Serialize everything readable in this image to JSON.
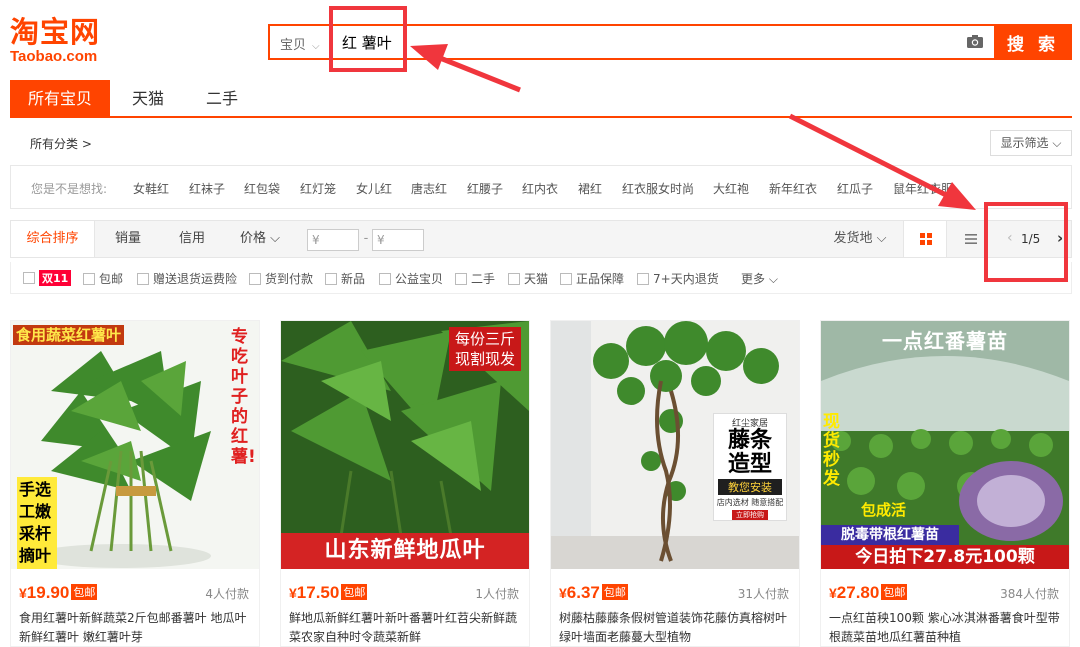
{
  "header": {
    "logo_cn": "淘宝网",
    "logo_en": "Taobao.com",
    "search_type": "宝贝",
    "search_value": "红 薯叶",
    "search_button": "搜 索"
  },
  "tabs": [
    {
      "label": "所有宝贝"
    },
    {
      "label": "天猫"
    },
    {
      "label": "二手"
    }
  ],
  "category": {
    "all_label": "所有分类 >",
    "show_filter": "显示筛选 ⌵"
  },
  "suggest": {
    "label": "您是不是想找:",
    "items": [
      "女鞋红",
      "红袜子",
      "红包袋",
      "红灯笼",
      "女儿红",
      "唐志红",
      "红腰子",
      "红内衣",
      "裙红",
      "红衣服女时尚",
      "大红袍",
      "新年红衣",
      "红瓜子",
      "鼠年红衣服"
    ]
  },
  "sortbar": {
    "items": [
      "综合排序",
      "销量",
      "信用",
      "价格 ⌵"
    ],
    "price_from": "¥",
    "price_to": "¥",
    "dash": "-",
    "ship_from": "发货地 ⌵",
    "pager": "1/5"
  },
  "filters": {
    "d11": "双11",
    "items": [
      "包邮",
      "赠送退货运费险",
      "货到付款",
      "新品",
      "公益宝贝",
      "二手",
      "天猫",
      "正品保障",
      "7+天内退货"
    ],
    "more": "更多 ⌵"
  },
  "products": [
    {
      "price": "19.90",
      "yen": "¥",
      "badge": "包邮",
      "paid": "4人付款",
      "title": "食用红薯叶新鲜蔬菜2斤包邮番薯叶 地瓜叶新鲜红薯叶 嫩红薯叶芽",
      "img_top": "食用蔬菜红薯叶",
      "img_side": "专吃叶子的红薯!",
      "img_bottom": "手选工嫩采杆摘叶"
    },
    {
      "price": "17.50",
      "yen": "¥",
      "badge": "包邮",
      "paid": "1人付款",
      "title": "鲜地瓜新鲜红薯叶新叶番薯叶红苕尖新鲜蔬菜农家自种时令蔬菜新鲜",
      "img_top1": "每份三斤",
      "img_top2": "现割现发",
      "img_bottom": "山东新鲜地瓜叶"
    },
    {
      "price": "6.37",
      "yen": "¥",
      "badge": "包邮",
      "paid": "31人付款",
      "title": "树藤枯藤藤条假树管道装饰花藤仿真榕树叶绿叶墙面老藤蔓大型植物",
      "img_brand": "红尘家居",
      "img_main": "藤条造型",
      "img_install": "教您安装",
      "img_sub": "店内选材 随意搭配",
      "img_btn": "立即抢购"
    },
    {
      "price": "27.80",
      "yen": "¥",
      "badge": "包邮",
      "paid": "384人付款",
      "title": "一点红苗秧100颗 紫心冰淇淋番薯食叶型带根蔬菜苗地瓜红薯苗种植",
      "img_top": "一点红番薯苗",
      "img_side": "现货秒发",
      "img_alive": "包成活",
      "img_band": "脱毒带根红薯苗",
      "img_bottom": "今日拍下27.8元100颗"
    }
  ],
  "colors": {
    "accent": "#ff4400",
    "annotation": "#f0363d"
  }
}
